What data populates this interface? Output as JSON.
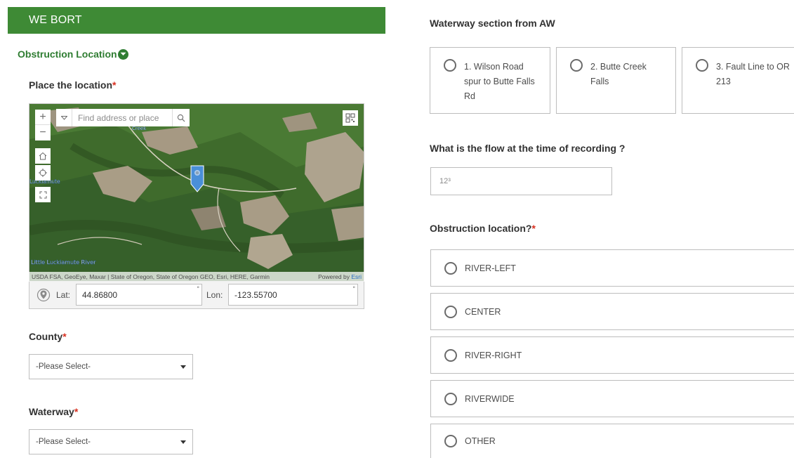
{
  "banner": {
    "title": "WE BORT"
  },
  "group": {
    "title": "Obstruction Location"
  },
  "location": {
    "label": "Place the location",
    "required_mark": "*",
    "search_placeholder": "Find address or place",
    "attribution": "USDA FSA, GeoEye, Maxar | State of Oregon, State of Oregon GEO, Esri, HERE, Garmin",
    "powered_by": "Powered by",
    "esri": "Esri",
    "river_label_1": "Little Luckiamute River",
    "river_label_2": "Luckiamute",
    "creek_label": "Creek",
    "lat_label": "Lat:",
    "lat_value": "44.86800",
    "lon_label": "Lon:",
    "lon_value": "-123.55700",
    "deg": "°"
  },
  "county": {
    "label": "County",
    "required_mark": "*",
    "value": "-Please Select-"
  },
  "waterway": {
    "label": "Waterway",
    "required_mark": "*",
    "value": "-Please Select-"
  },
  "section": {
    "label": "Waterway section from AW",
    "options": [
      {
        "line1": "1. Wilson Road",
        "line2": "spur to Butte Falls",
        "line3": "Rd"
      },
      {
        "line1": "2. Butte Creek",
        "line2": "Falls"
      },
      {
        "line1": "3. Fault Line to OR",
        "line2": "213"
      }
    ]
  },
  "flow": {
    "label": "What is the flow at the time of recording ?",
    "placeholder": "12³"
  },
  "obstruction": {
    "label": "Obstruction location?",
    "required_mark": "*",
    "options": [
      "RIVER-LEFT",
      "CENTER",
      "RIVER-RIGHT",
      "RIVERWIDE",
      "OTHER"
    ]
  },
  "colors": {
    "accent": "#3e8a35",
    "required": "#d83020",
    "pin": "#4a8fd8"
  },
  "icons": [
    "chevron-down-icon",
    "zoom-in-icon",
    "zoom-out-icon",
    "home-icon",
    "locate-icon",
    "fullscreen-icon",
    "search-icon",
    "qr-code-icon",
    "location-pin-icon",
    "location-target-icon",
    "dropdown-caret-icon"
  ]
}
